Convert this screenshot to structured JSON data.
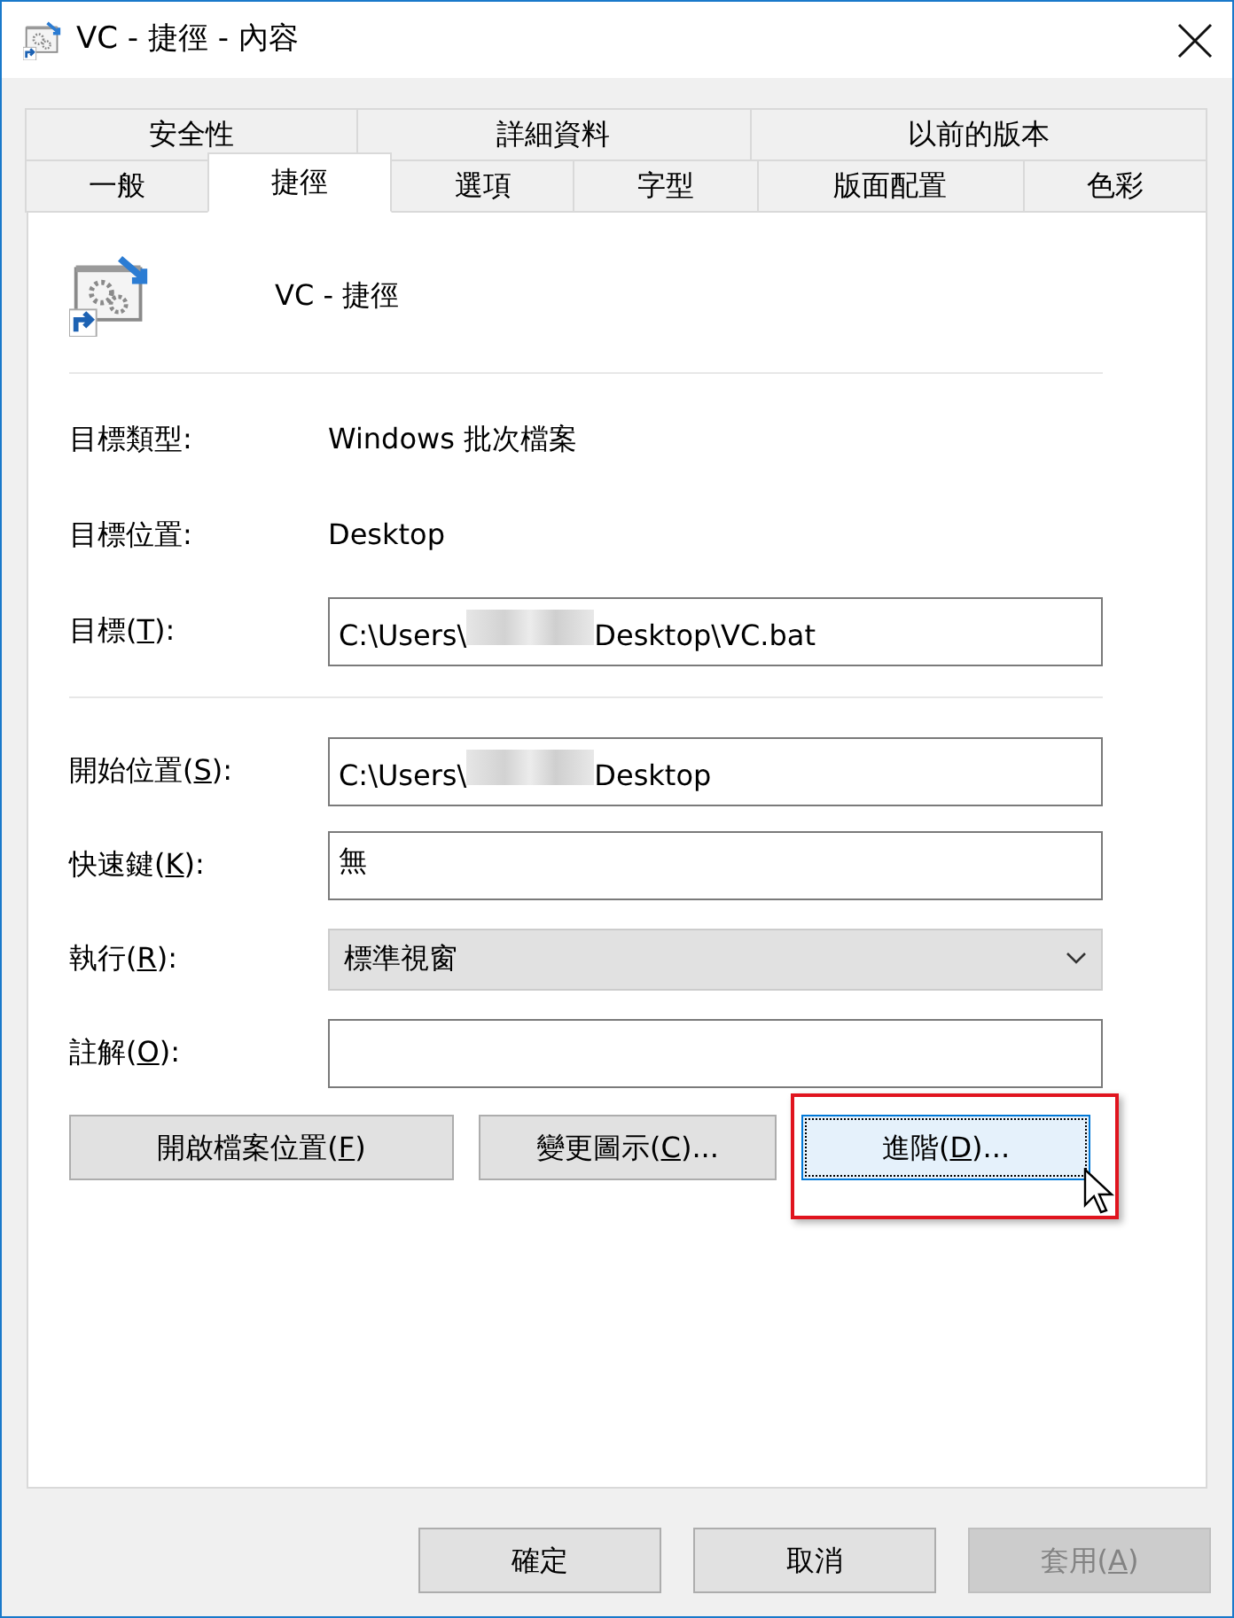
{
  "window": {
    "title": "VC - 捷徑 - 內容"
  },
  "tab_rows": [
    [
      {
        "label": "安全性",
        "selected": false
      },
      {
        "label": "詳細資料",
        "selected": false
      },
      {
        "label": "以前的版本",
        "selected": false
      }
    ],
    [
      {
        "label": "一般",
        "selected": false
      },
      {
        "label": "捷徑",
        "selected": true
      },
      {
        "label": "選項",
        "selected": false
      },
      {
        "label": "字型",
        "selected": false
      },
      {
        "label": "版面配置",
        "selected": false
      },
      {
        "label": "色彩",
        "selected": false
      }
    ]
  ],
  "shortcut_name": "VC - 捷徑",
  "fields_top": [
    {
      "kind": "info",
      "label": [
        "目標類型:"
      ],
      "value": "Windows 批次檔案"
    },
    {
      "kind": "info",
      "label": [
        "目標位置:"
      ],
      "value": "Desktop"
    },
    {
      "kind": "text",
      "label": [
        "目標(",
        "T",
        "):"
      ],
      "value_before": "C:\\Users\\",
      "redacted": true,
      "value_after": "Desktop\\VC.bat"
    }
  ],
  "fields": [
    {
      "kind": "text",
      "label": [
        "開始位置(",
        "S",
        "):"
      ],
      "value_before": "C:\\Users\\",
      "redacted": true,
      "value_after": "Desktop"
    },
    {
      "kind": "text",
      "label": [
        "快速鍵(",
        "K",
        "):"
      ],
      "value_before": "無"
    },
    {
      "kind": "select",
      "label": [
        "執行(",
        "R",
        "):"
      ],
      "value_before": "標準視窗"
    },
    {
      "kind": "text",
      "label": [
        "註解(",
        "O",
        "):"
      ]
    }
  ],
  "action_buttons": [
    {
      "label": [
        "開啟檔案位置(",
        "F",
        ")"
      ],
      "focused": false,
      "highlighted": false,
      "pointer": false
    },
    {
      "label": [
        "變更圖示(",
        "C",
        ")..."
      ],
      "focused": false,
      "highlighted": false,
      "pointer": false
    },
    {
      "label": [
        "進階(",
        "D",
        ")..."
      ],
      "focused": true,
      "highlighted": true,
      "pointer": true
    }
  ],
  "footer_buttons": [
    {
      "label": [
        "確定"
      ],
      "disabled": false
    },
    {
      "label": [
        "取消"
      ],
      "disabled": false
    },
    {
      "label": [
        "套用(",
        "A",
        ")"
      ],
      "disabled": true
    }
  ]
}
